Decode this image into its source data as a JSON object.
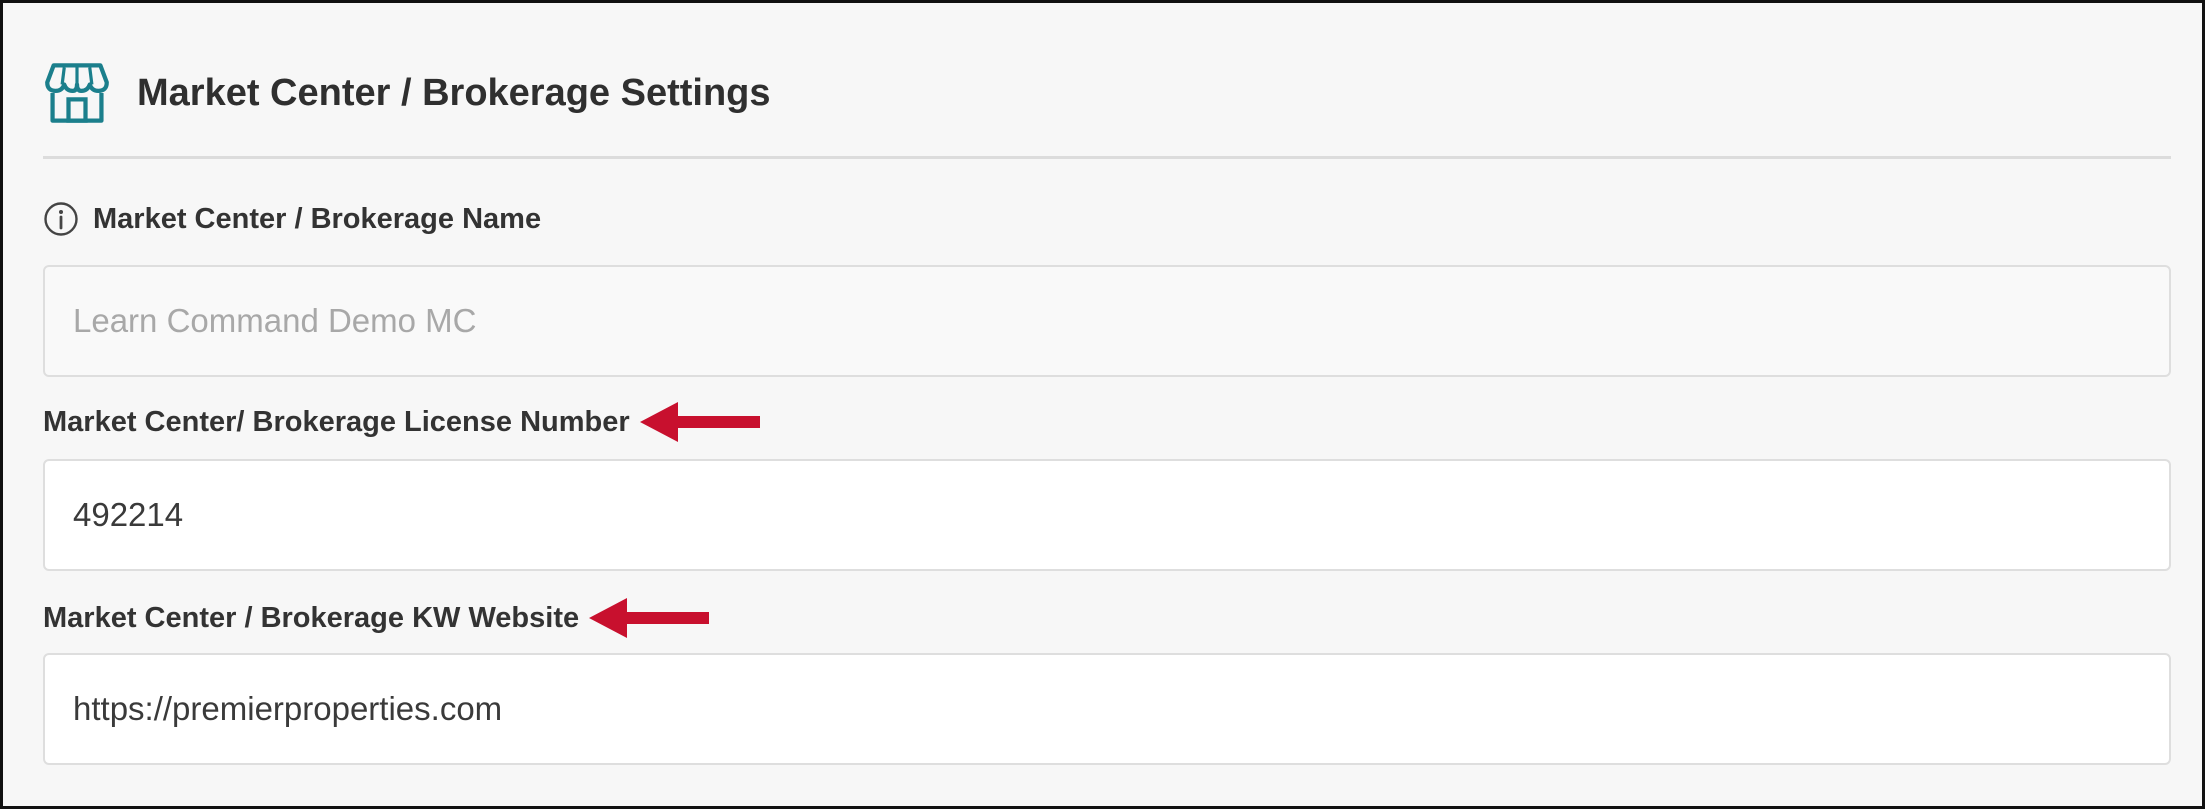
{
  "header": {
    "icon": "storefront-icon",
    "title": "Market Center / Brokerage Settings"
  },
  "colors": {
    "accent": "#1b7f8c",
    "annotation_arrow": "#c8102e"
  },
  "fields": [
    {
      "label": "Market Center / Brokerage Name",
      "label_icon": "info-icon",
      "value": "Learn Command Demo MC",
      "state": "disabled"
    },
    {
      "label": "Market Center/ Brokerage License Number",
      "value": "492214",
      "annotation": "red-arrow-icon"
    },
    {
      "label": "Market Center / Brokerage KW Website",
      "value": "https://premierproperties.com",
      "annotation": "red-arrow-icon"
    }
  ]
}
